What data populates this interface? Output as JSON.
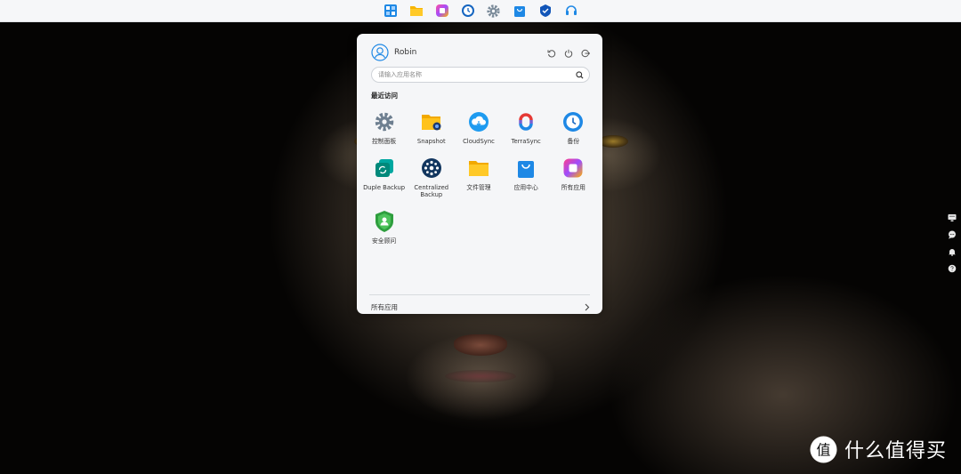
{
  "taskbar": {
    "icons": [
      "start-menu-icon",
      "file-folder-icon",
      "all-apps-icon",
      "backup-clock-icon",
      "control-panel-gear-icon",
      "app-center-bag-icon",
      "shield-app-icon",
      "support-headset-icon"
    ]
  },
  "start_menu": {
    "user": {
      "name": "Robin"
    },
    "actions": [
      "restart-icon",
      "power-icon",
      "logout-icon"
    ],
    "search": {
      "placeholder": "请输入应用名称",
      "value": ""
    },
    "recent_title": "最近访问",
    "apps": [
      {
        "label": "控制面板",
        "icon": "gear-icon"
      },
      {
        "label": "Snapshot",
        "icon": "snapshot-folder-icon"
      },
      {
        "label": "CloudSync",
        "icon": "cloudsync-icon"
      },
      {
        "label": "TerraSync",
        "icon": "terrasync-icon"
      },
      {
        "label": "备份",
        "icon": "backup-clock-icon"
      },
      {
        "label": "Duple Backup",
        "icon": "duple-backup-icon"
      },
      {
        "label": "Centralized Backup",
        "icon": "centralized-backup-icon"
      },
      {
        "label": "文件管理",
        "icon": "file-manager-folder-icon"
      },
      {
        "label": "应用中心",
        "icon": "app-center-bag-icon"
      },
      {
        "label": "所有应用",
        "icon": "all-apps-icon"
      },
      {
        "label": "安全顾问",
        "icon": "security-advisor-shield-icon"
      }
    ],
    "footer": {
      "label": "所有应用"
    }
  },
  "side_widgets": [
    "monitor-icon",
    "chat-icon",
    "bell-icon",
    "help-icon"
  ],
  "watermark": {
    "text": "什么值得买",
    "logo_char": "值"
  },
  "colors": {
    "panel": "#f5f6f8",
    "accent_blue": "#1e88e5",
    "taskbar": "#f6f7f9"
  }
}
